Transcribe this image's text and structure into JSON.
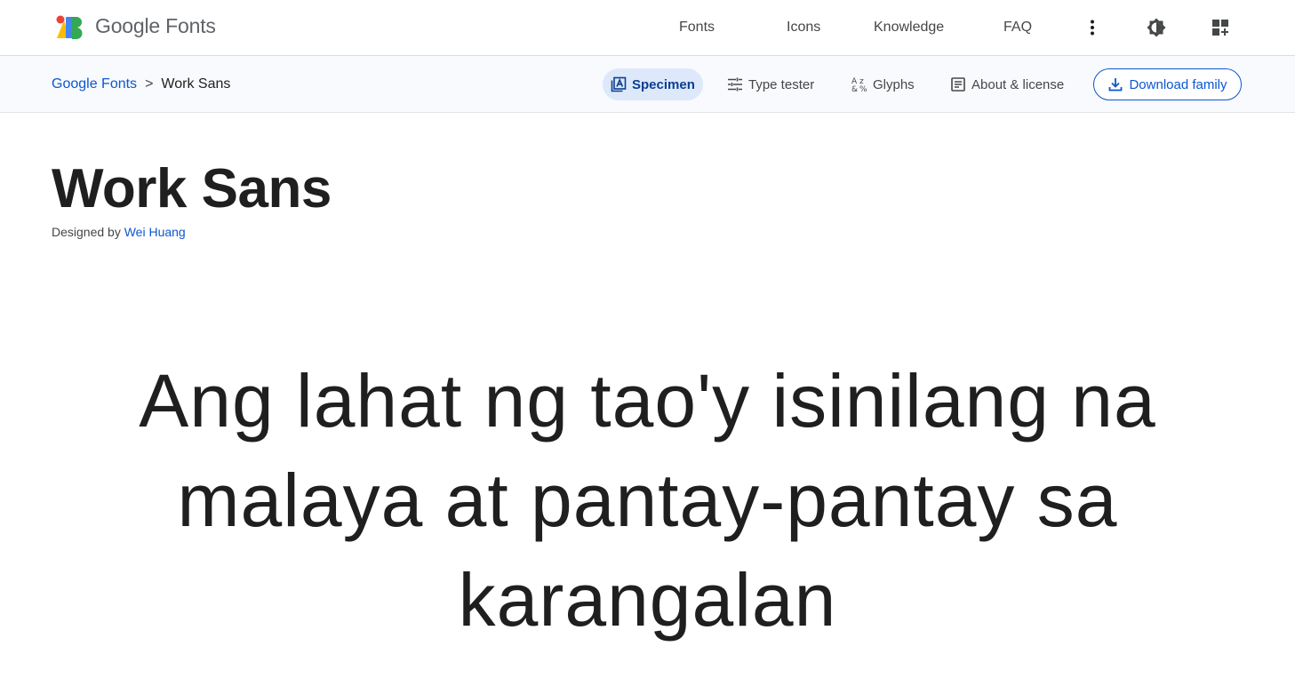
{
  "header": {
    "brand": "Google Fonts",
    "nav": [
      "Fonts",
      "Icons",
      "Knowledge",
      "FAQ"
    ],
    "icons": [
      "more-vert-icon",
      "brightness-icon",
      "apps-icon"
    ],
    "logo_colors": [
      "#EA4335",
      "#FBBC04",
      "#4285F4",
      "#34A853"
    ]
  },
  "subbar": {
    "breadcrumb": {
      "root": "Google Fonts",
      "separator": ">",
      "current": "Work Sans"
    },
    "tabs": [
      {
        "label": "Specimen",
        "icon": "specimen-icon",
        "active": true
      },
      {
        "label": "Type tester",
        "icon": "sliders-icon",
        "active": false
      },
      {
        "label": "Glyphs",
        "icon": "glyphs-icon",
        "active": false
      },
      {
        "label": "About & license",
        "icon": "article-icon",
        "active": false
      }
    ],
    "download_label": "Download family"
  },
  "font": {
    "name": "Work Sans",
    "designed_by": "Designed by",
    "designer": "Wei Huang"
  },
  "specimen": {
    "text": "Ang lahat ng tao'y isinilang na malaya at pantay-pantay sa karangalan"
  },
  "colors": {
    "accent": "#0b57d0",
    "active_tab_bg": "#dde8fb",
    "subbar_bg": "#f8fafd"
  }
}
